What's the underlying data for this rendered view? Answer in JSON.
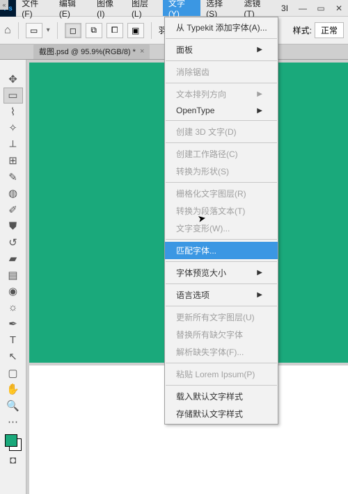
{
  "menubar": {
    "items": [
      "文件(F)",
      "编辑(E)",
      "图像(I)",
      "图层(L)",
      "文字(Y)",
      "选择(S)",
      "滤镜(T)",
      "3I"
    ],
    "open_index": 4
  },
  "optbar": {
    "feather_label": "羽",
    "style_label": "样式:",
    "style_value": "正常"
  },
  "doc_tab": {
    "label": "截图.psd @ 95.9%(RGB/8) *"
  },
  "dropdown": {
    "rows": [
      {
        "label": "从 Typekit 添加字体(A)...",
        "disabled": false,
        "sub": false
      },
      {
        "sep": true
      },
      {
        "label": "面板",
        "disabled": false,
        "sub": true
      },
      {
        "sep": true
      },
      {
        "label": "消除锯齿",
        "disabled": true,
        "sub": false
      },
      {
        "sep": true
      },
      {
        "label": "文本排列方向",
        "disabled": true,
        "sub": true
      },
      {
        "label": "OpenType",
        "disabled": false,
        "sub": true
      },
      {
        "sep": true
      },
      {
        "label": "创建 3D 文字(D)",
        "disabled": true,
        "sub": false
      },
      {
        "sep": true
      },
      {
        "label": "创建工作路径(C)",
        "disabled": true,
        "sub": false
      },
      {
        "label": "转换为形状(S)",
        "disabled": true,
        "sub": false
      },
      {
        "sep": true
      },
      {
        "label": "栅格化文字图层(R)",
        "disabled": true,
        "sub": false
      },
      {
        "label": "转换为段落文本(T)",
        "disabled": true,
        "sub": false
      },
      {
        "label": "文字变形(W)...",
        "disabled": true,
        "sub": false
      },
      {
        "sep": true
      },
      {
        "label": "匹配字体...",
        "disabled": false,
        "sub": false,
        "hl": true
      },
      {
        "sep": true
      },
      {
        "label": "字体预览大小",
        "disabled": false,
        "sub": true
      },
      {
        "sep": true
      },
      {
        "label": "语言选项",
        "disabled": false,
        "sub": true
      },
      {
        "sep": true
      },
      {
        "label": "更新所有文字图层(U)",
        "disabled": true,
        "sub": false
      },
      {
        "label": "替换所有缺欠字体",
        "disabled": true,
        "sub": false
      },
      {
        "label": "解析缺失字体(F)...",
        "disabled": true,
        "sub": false
      },
      {
        "sep": true
      },
      {
        "label": "粘贴 Lorem Ipsum(P)",
        "disabled": true,
        "sub": false
      },
      {
        "sep": true
      },
      {
        "label": "载入默认文字样式",
        "disabled": false,
        "sub": false
      },
      {
        "label": "存储默认文字样式",
        "disabled": false,
        "sub": false
      }
    ]
  },
  "canvas": {
    "fill": "#1aa97b"
  }
}
